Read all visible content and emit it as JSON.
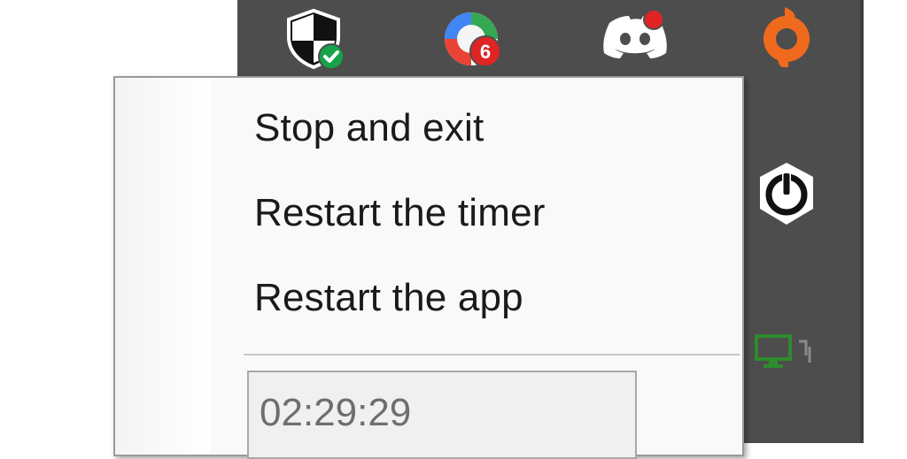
{
  "tray": {
    "icons": [
      {
        "name": "windows-security-icon",
        "color": "#ffffff",
        "badge_color": "#16a34a"
      },
      {
        "name": "google-one-icon",
        "badge": "6",
        "badge_color": "#e02424"
      },
      {
        "name": "discord-icon",
        "badge_color": "#e02424"
      },
      {
        "name": "origin-icon",
        "color": "#f06a1d"
      },
      {
        "name": "power-timer-icon",
        "color": "#ffffff"
      },
      {
        "name": "display-network-icon",
        "color": "#2e8b2e"
      }
    ]
  },
  "context_menu": {
    "items": [
      {
        "label": "Stop and exit"
      },
      {
        "label": "Restart the timer"
      },
      {
        "label": "Restart the app"
      }
    ],
    "timer_value": "02:29:29"
  }
}
